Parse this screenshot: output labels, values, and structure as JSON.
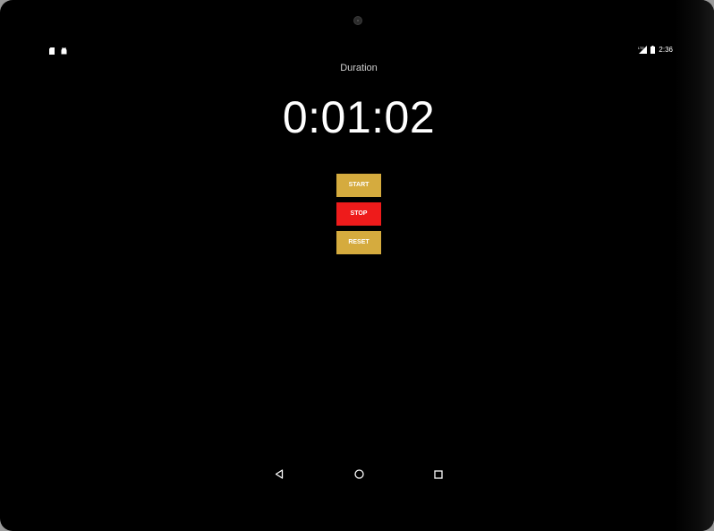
{
  "status_bar": {
    "time": "2:36",
    "left_icons": [
      "sd-card-icon",
      "android-icon"
    ],
    "right_icons": [
      "signal-icon",
      "battery-icon"
    ]
  },
  "stopwatch": {
    "label": "Duration",
    "time": "0:01:02"
  },
  "buttons": {
    "start": "START",
    "stop": "STOP",
    "reset": "RESET"
  },
  "nav_bar": {
    "icons": [
      "back-icon",
      "home-icon",
      "recents-icon"
    ]
  },
  "colors": {
    "background": "#000000",
    "start_button": "#d5ab3e",
    "stop_button": "#ee1b1b",
    "reset_button": "#d5ab3e",
    "text": "#ffffff"
  }
}
